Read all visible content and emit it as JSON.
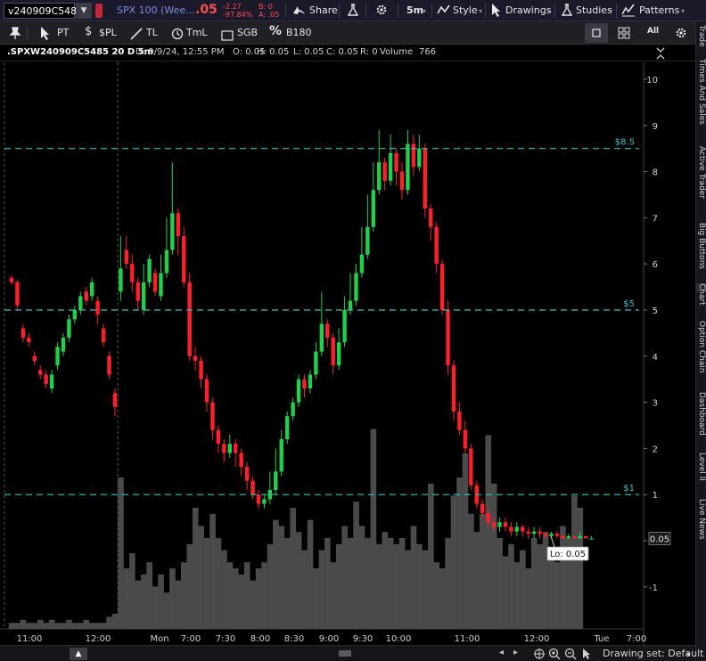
{
  "toolbar": {
    "symbol_value": "v240909C5485",
    "description": "SPX 100 (Wee...",
    "last_price": ".05",
    "change": "-2.27",
    "change_pct": "-97.84%",
    "bid": "B: 0",
    "ask": "A: .05",
    "share_label": "Share",
    "interval_label": "5m",
    "style_label": "Style",
    "drawings_label": "Drawings",
    "studies_label": "Studies",
    "patterns_label": "Patterns",
    "colors": {
      "price_down": "#ff4d4d",
      "text_blue": "#7f8ae0",
      "accent": "#5b6ee1"
    }
  },
  "drawing_tools": [
    {
      "label": "PT",
      "icon": "pointer-icon"
    },
    {
      "label": "$PL",
      "icon": "dollar-icon"
    },
    {
      "label": "TL",
      "icon": "trendline-icon"
    },
    {
      "label": "TmL",
      "icon": "clock-icon"
    },
    {
      "label": "SGB",
      "icon": "rectangle-icon"
    },
    {
      "label": "B180",
      "icon": "percent-icon"
    }
  ],
  "layout_controls": {
    "single_icon": "single-layout-icon",
    "grid_icon": "grid-layout-icon",
    "all_label": "All",
    "settings_icon": "gear-icon"
  },
  "chart_header": {
    "symbol": ".SPXW240909C5485 20 D 5m",
    "date": "D: 9/9/24, 12:55 PM",
    "open": "O: 0.05",
    "high": "H: 0.05",
    "low": "L: 0.05",
    "close": "C: 0.05",
    "range": "R: 0",
    "volume_label": "Volume",
    "volume_value": "766"
  },
  "sidebar_tabs": [
    "Trade",
    "Times And Sales",
    "Active Trader",
    "Big Buttons",
    "Chart",
    "Option Chain",
    "Dashboard",
    "Level II",
    "Live News"
  ],
  "chart_data": {
    "type": "candlestick",
    "y_ticks": [
      "10",
      "9",
      "8",
      "7",
      "6",
      "5",
      "4",
      "3",
      "2",
      "1",
      "0",
      "-1"
    ],
    "ylim": [
      -1.95,
      10.35
    ],
    "price_lines": [
      {
        "label": "$8.5",
        "value": 8.5
      },
      {
        "label": "$5",
        "value": 5
      },
      {
        "label": "$1",
        "value": 1
      }
    ],
    "last_price_tag": "0.05",
    "low_tag": "Lo: 0.05",
    "x_ticks": [
      "11:00",
      "12:00",
      "Mon",
      "7:00",
      "7:30",
      "8:00",
      "8:30",
      "9:00",
      "9:30",
      "10:00",
      "11:00",
      "12:00",
      "Tue",
      "7:00"
    ],
    "session_breaks_after_bar": [
      18,
      148
    ],
    "candles": [
      [
        5.7,
        5.6,
        5.75,
        5.55
      ],
      [
        5.6,
        5.1,
        5.65,
        5.0
      ],
      [
        4.6,
        4.4,
        4.7,
        4.3
      ],
      [
        4.4,
        4.3,
        4.5,
        4.2
      ],
      [
        4.0,
        3.9,
        4.1,
        3.8
      ],
      [
        3.7,
        3.6,
        3.8,
        3.5
      ],
      [
        3.6,
        3.4,
        3.7,
        3.3
      ],
      [
        3.3,
        3.6,
        3.7,
        3.2
      ],
      [
        3.8,
        4.2,
        4.3,
        3.7
      ],
      [
        4.1,
        4.4,
        4.5,
        4.0
      ],
      [
        4.4,
        4.8,
        4.9,
        4.3
      ],
      [
        4.8,
        5.0,
        5.1,
        4.7
      ],
      [
        5.0,
        5.3,
        5.4,
        4.9
      ],
      [
        5.4,
        5.2,
        5.5,
        5.1
      ],
      [
        5.3,
        5.6,
        5.7,
        5.2
      ],
      [
        5.2,
        4.9,
        5.3,
        4.7
      ],
      [
        4.6,
        4.3,
        4.7,
        4.2
      ],
      [
        4.0,
        3.6,
        4.1,
        3.5
      ],
      [
        3.2,
        2.9,
        3.3,
        2.7
      ],
      [
        5.4,
        5.9,
        6.6,
        5.2
      ],
      [
        6.3,
        6.0,
        6.6,
        5.9
      ],
      [
        6.0,
        5.6,
        6.2,
        5.4
      ],
      [
        5.6,
        5.2,
        5.7,
        5.0
      ],
      [
        5.0,
        5.6,
        6.0,
        4.9
      ],
      [
        5.6,
        6.1,
        6.2,
        5.5
      ],
      [
        5.8,
        5.4,
        5.9,
        5.3
      ],
      [
        5.3,
        5.8,
        6.2,
        5.2
      ],
      [
        5.8,
        6.3,
        7.0,
        5.7
      ],
      [
        6.3,
        7.1,
        8.2,
        6.2
      ],
      [
        7.1,
        6.6,
        7.2,
        6.2
      ],
      [
        6.6,
        5.6,
        6.8,
        5.5
      ],
      [
        5.6,
        4.0,
        5.8,
        3.9
      ],
      [
        4.0,
        3.9,
        4.2,
        3.7
      ],
      [
        3.9,
        3.5,
        4.0,
        3.3
      ],
      [
        3.5,
        3.0,
        3.6,
        2.8
      ],
      [
        3.0,
        2.4,
        3.1,
        2.2
      ],
      [
        2.4,
        2.1,
        2.5,
        1.9
      ],
      [
        2.1,
        1.9,
        2.2,
        1.7
      ],
      [
        1.9,
        2.1,
        2.3,
        1.8
      ],
      [
        2.1,
        1.9,
        2.2,
        1.6
      ],
      [
        1.9,
        1.6,
        2.0,
        1.4
      ],
      [
        1.6,
        1.3,
        1.7,
        1.1
      ],
      [
        1.3,
        1.0,
        1.4,
        0.9
      ],
      [
        1.0,
        0.8,
        1.1,
        0.7
      ],
      [
        0.8,
        0.9,
        1.0,
        0.7
      ],
      [
        0.9,
        1.1,
        1.5,
        0.8
      ],
      [
        1.1,
        1.5,
        2.0,
        1.0
      ],
      [
        1.5,
        2.2,
        2.4,
        1.4
      ],
      [
        2.2,
        2.7,
        2.8,
        2.1
      ],
      [
        2.7,
        3.0,
        3.1,
        2.6
      ],
      [
        3.0,
        3.5,
        3.6,
        2.9
      ],
      [
        3.5,
        3.3,
        3.6,
        3.1
      ],
      [
        3.3,
        3.6,
        3.7,
        3.2
      ],
      [
        3.6,
        4.1,
        4.3,
        3.5
      ],
      [
        4.1,
        4.7,
        5.4,
        4.0
      ],
      [
        4.7,
        4.4,
        4.8,
        4.2
      ],
      [
        4.4,
        3.8,
        4.5,
        3.6
      ],
      [
        3.8,
        4.3,
        4.6,
        3.7
      ],
      [
        4.3,
        5.0,
        5.3,
        4.2
      ],
      [
        5.0,
        5.2,
        5.8,
        4.9
      ],
      [
        5.2,
        5.8,
        6.0,
        5.1
      ],
      [
        5.8,
        6.2,
        6.8,
        5.7
      ],
      [
        6.2,
        6.8,
        7.5,
        6.1
      ],
      [
        6.8,
        7.6,
        8.2,
        6.7
      ],
      [
        7.6,
        8.2,
        8.9,
        7.5
      ],
      [
        8.2,
        7.8,
        8.3,
        7.6
      ],
      [
        7.8,
        8.4,
        8.8,
        7.7
      ],
      [
        8.4,
        8.0,
        8.5,
        7.7
      ],
      [
        8.0,
        7.6,
        8.2,
        7.4
      ],
      [
        7.6,
        8.6,
        8.9,
        7.5
      ],
      [
        8.6,
        8.1,
        8.8,
        7.9
      ],
      [
        8.1,
        8.5,
        8.8,
        8.0
      ],
      [
        8.5,
        7.2,
        8.6,
        7.0
      ],
      [
        7.2,
        6.8,
        7.3,
        6.5
      ],
      [
        6.8,
        6.0,
        6.9,
        5.8
      ],
      [
        6.0,
        5.0,
        6.1,
        4.9
      ],
      [
        5.0,
        3.8,
        5.2,
        3.6
      ],
      [
        3.8,
        2.8,
        3.9,
        2.6
      ],
      [
        2.8,
        2.4,
        3.0,
        2.3
      ],
      [
        2.4,
        2.0,
        2.6,
        1.9
      ],
      [
        2.0,
        1.2,
        2.1,
        1.1
      ],
      [
        1.2,
        0.8,
        1.3,
        0.7
      ],
      [
        0.8,
        0.6,
        0.9,
        0.5
      ],
      [
        0.6,
        0.4,
        0.7,
        0.3
      ],
      [
        0.4,
        0.3,
        0.5,
        0.2
      ],
      [
        0.3,
        0.4,
        0.5,
        0.2
      ],
      [
        0.4,
        0.3,
        0.5,
        0.2
      ],
      [
        0.3,
        0.2,
        0.4,
        0.1
      ],
      [
        0.2,
        0.3,
        0.4,
        0.1
      ],
      [
        0.3,
        0.2,
        0.35,
        0.1
      ],
      [
        0.2,
        0.15,
        0.3,
        0.05
      ],
      [
        0.15,
        0.2,
        0.3,
        0.05
      ],
      [
        0.2,
        0.15,
        0.3,
        0.05
      ],
      [
        0.15,
        0.1,
        0.2,
        0.05
      ],
      [
        0.1,
        0.15,
        0.2,
        0.05
      ],
      [
        0.15,
        0.1,
        0.2,
        0.05
      ],
      [
        0.1,
        0.05,
        0.15,
        0.05
      ],
      [
        0.05,
        0.1,
        0.15,
        0.05
      ],
      [
        0.1,
        0.05,
        0.1,
        0.05
      ],
      [
        0.05,
        0.1,
        0.2,
        0.05
      ],
      [
        0.1,
        0.05,
        0.1,
        0.05
      ],
      [
        0.05,
        0.05,
        0.1,
        0.05
      ]
    ],
    "volume_scale": "shares (normalized 0-1)",
    "volumes": [
      0.02,
      0.02,
      0.03,
      0.02,
      0.02,
      0.03,
      0.02,
      0.03,
      0.02,
      0.02,
      0.03,
      0.02,
      0.02,
      0.03,
      0.02,
      0.02,
      0.02,
      0.04,
      0.05,
      0.5,
      0.2,
      0.25,
      0.16,
      0.18,
      0.22,
      0.14,
      0.18,
      0.12,
      0.2,
      0.16,
      0.22,
      0.28,
      0.4,
      0.34,
      0.3,
      0.38,
      0.3,
      0.26,
      0.22,
      0.2,
      0.18,
      0.22,
      0.16,
      0.2,
      0.22,
      0.28,
      0.36,
      0.34,
      0.3,
      0.4,
      0.32,
      0.26,
      0.36,
      0.2,
      0.26,
      0.3,
      0.22,
      0.28,
      0.34,
      0.3,
      0.42,
      0.34,
      0.3,
      0.66,
      0.28,
      0.32,
      0.3,
      0.28,
      0.3,
      0.26,
      0.34,
      0.28,
      0.26,
      0.48,
      0.22,
      0.2,
      0.3,
      0.44,
      0.5,
      0.58,
      0.38,
      0.32,
      0.38,
      0.64,
      0.48,
      0.3,
      0.24,
      0.28,
      0.22,
      0.26,
      0.2,
      0.3,
      0.28,
      0.32,
      0.26,
      0.22,
      0.34,
      0.3,
      0.44,
      0.4
    ]
  }
}
